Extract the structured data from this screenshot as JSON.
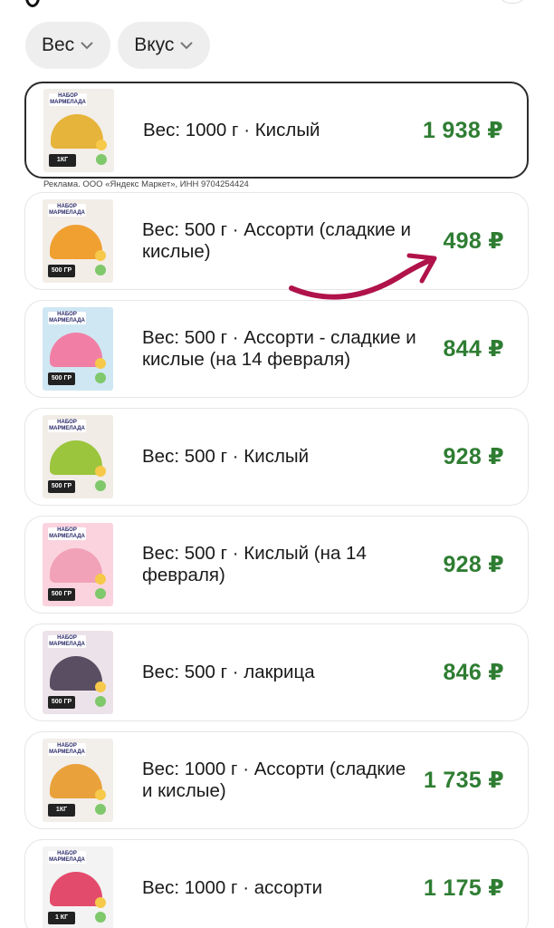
{
  "filters": [
    {
      "label": "Вес"
    },
    {
      "label": "Вкус"
    }
  ],
  "ad_note": "Реклама. ООО «Яндекс Маркет», ИНН 9704254424",
  "currency": "₽",
  "items": [
    {
      "title": "Вес: 1000 г · Кислый",
      "price": "1 938 ₽",
      "thumb_bg": "#f2eeea",
      "wedge": "#e6b43a",
      "tag": "1КГ",
      "selected": true
    },
    {
      "title": "Вес: 500 г · Ассорти (сладкие и кислые)",
      "price": "498 ₽",
      "thumb_bg": "#f3ede8",
      "wedge": "#f0a030",
      "tag": "500 ГР",
      "selected": false
    },
    {
      "title": "Вес: 500 г · Ассорти - сладкие и кислые (на 14 февраля)",
      "price": "844 ₽",
      "thumb_bg": "#cfe7f3",
      "wedge": "#f17fa5",
      "tag": "500 ГР",
      "selected": false
    },
    {
      "title": "Вес: 500 г · Кислый",
      "price": "928 ₽",
      "thumb_bg": "#f1ece6",
      "wedge": "#9bc53d",
      "tag": "500 ГР",
      "selected": false
    },
    {
      "title": "Вес: 500 г · Кислый (на 14 февраля)",
      "price": "928 ₽",
      "thumb_bg": "#fbd3df",
      "wedge": "#f1a2b8",
      "tag": "500 ГР",
      "selected": false
    },
    {
      "title": "Вес: 500 г · лакрица",
      "price": "846 ₽",
      "thumb_bg": "#ece3ea",
      "wedge": "#5a4e62",
      "tag": "500 ГР",
      "selected": false
    },
    {
      "title": "Вес: 1000 г · Ассорти (сладкие и кислые)",
      "price": "1 735 ₽",
      "thumb_bg": "#f2eeea",
      "wedge": "#e9a23b",
      "tag": "1КГ",
      "selected": false
    },
    {
      "title": "Вес: 1000 г · ассорти",
      "price": "1 175 ₽",
      "thumb_bg": "#f3f3f3",
      "wedge": "#e34b6c",
      "tag": "1 КГ",
      "selected": false
    }
  ],
  "colors": {
    "price": "#2e7d32",
    "arrow": "#b0124a",
    "chip_bg": "#eeeeee",
    "border": "#e6e6e6",
    "selected_border": "#2b2b2b"
  }
}
